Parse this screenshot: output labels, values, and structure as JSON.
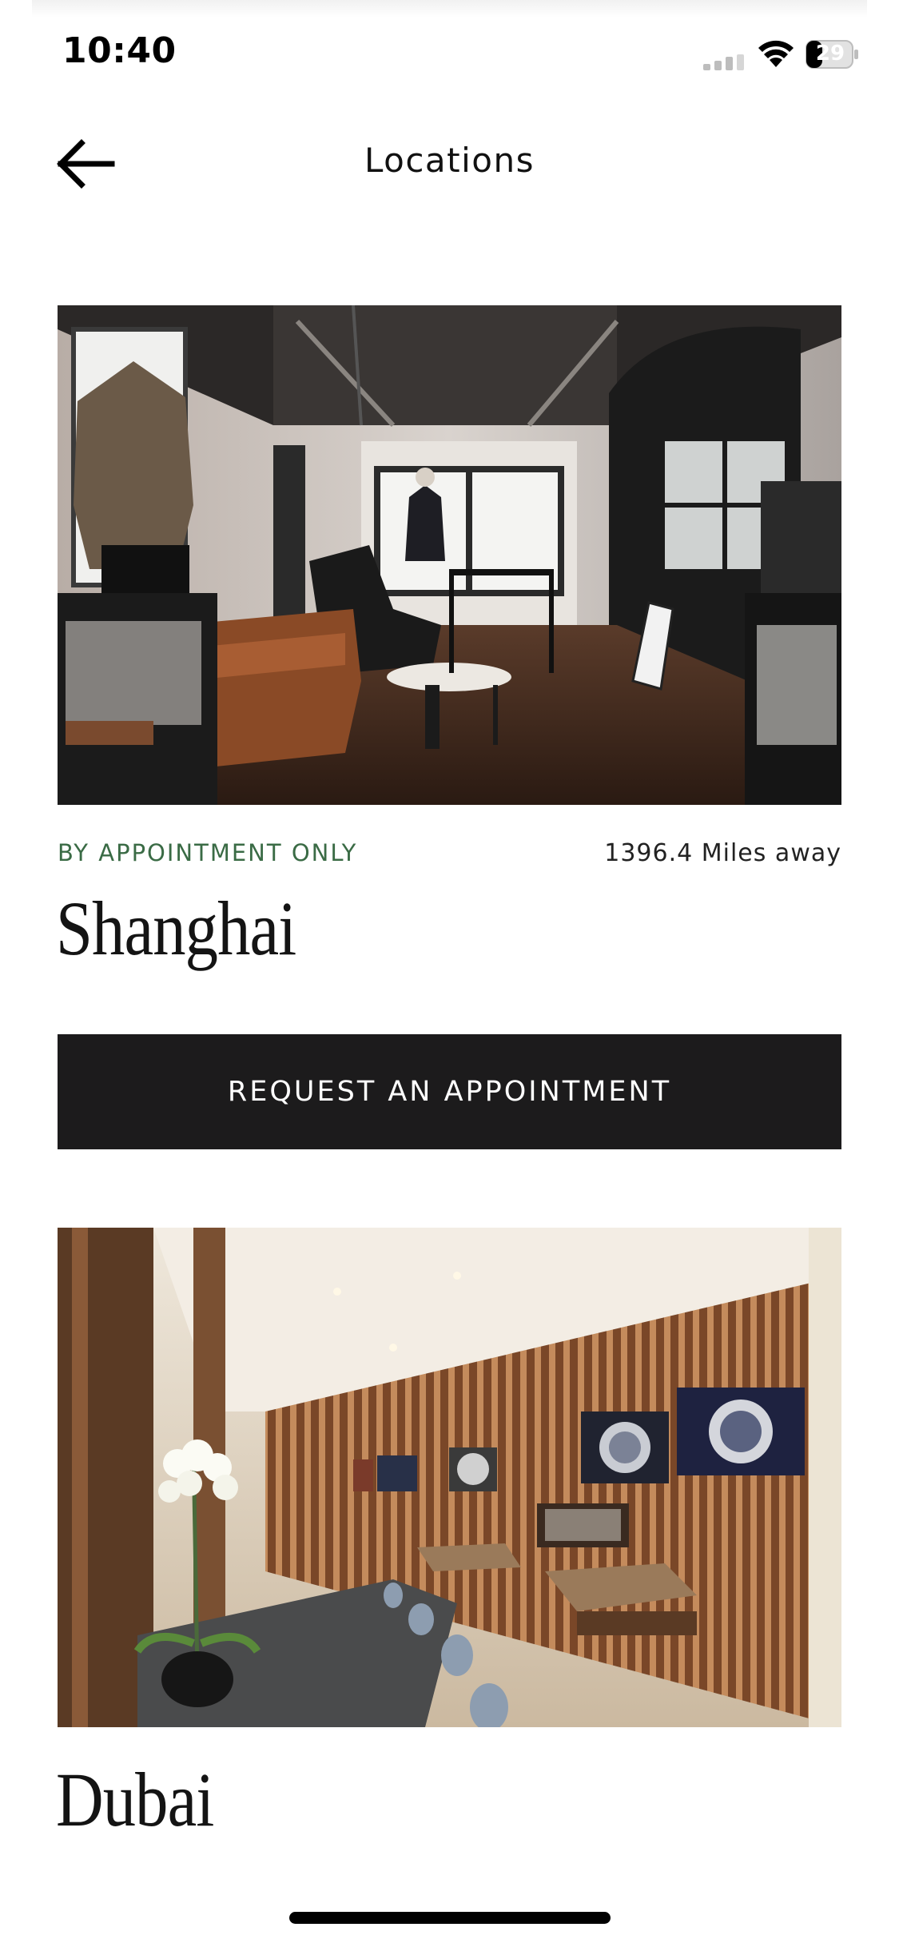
{
  "status_bar": {
    "time": "10:40",
    "battery_level": "29",
    "icons": [
      "cellular-signal-icon",
      "wifi-icon",
      "battery-icon"
    ]
  },
  "header": {
    "title": "Locations",
    "back_icon": "back-arrow-icon"
  },
  "locations": [
    {
      "tag": "BY APPOINTMENT ONLY",
      "distance": "1396.4 Miles away",
      "name": "Shanghai",
      "button_label": "REQUEST AN APPOINTMENT",
      "image_description": "boutique lounge interior"
    },
    {
      "name": "Dubai",
      "image_description": "boutique watch display interior"
    }
  ],
  "colors": {
    "accent_green": "#3a6b45",
    "button_bg": "#1c1b1c",
    "text": "#141414"
  }
}
